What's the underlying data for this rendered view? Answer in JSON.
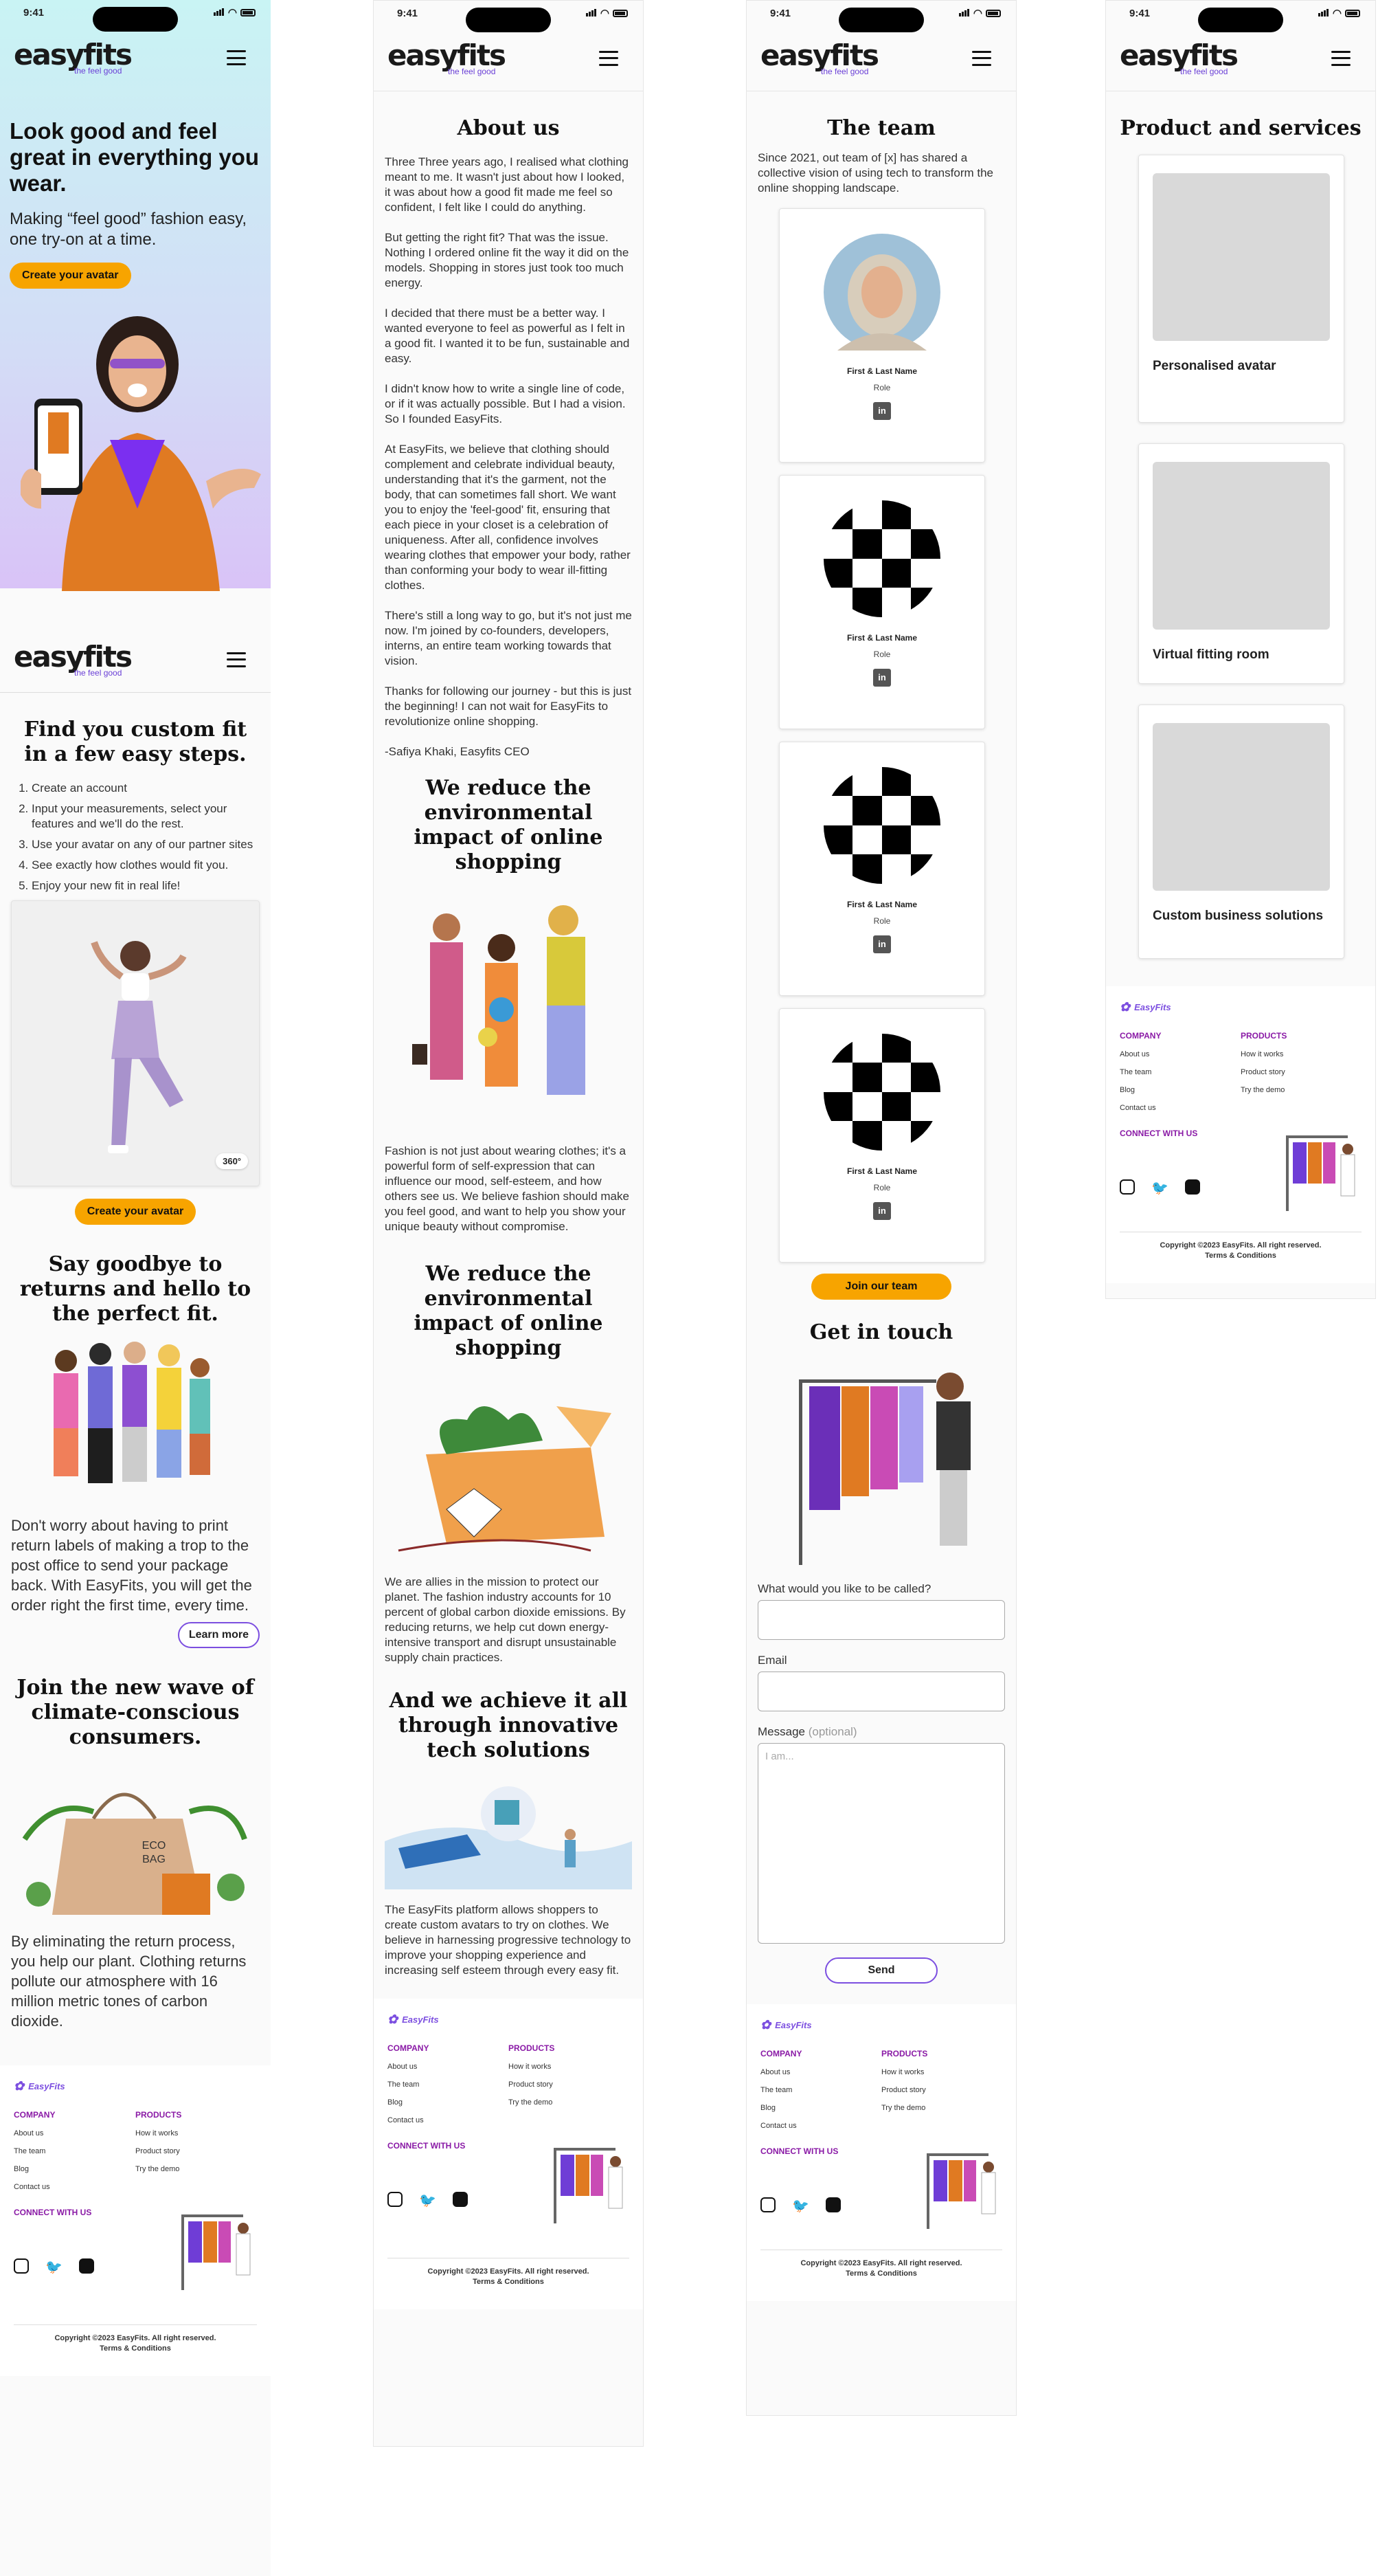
{
  "status": {
    "time": "9:41"
  },
  "brand": {
    "name": "easyfits",
    "tagline": "the feel good"
  },
  "screen1": {
    "hero_title": "Look good and feel great in everything you wear.",
    "hero_sub": "Making “feel good” fashion easy, one try-on at a time.",
    "hero_cta": "Create your avatar",
    "steps_title": "Find you custom fit in a few easy steps.",
    "steps": [
      "Create an account",
      "Input your measurements, select your features and we'll do the rest.",
      "Use your  avatar on any of our partner sites",
      "See exactly how clothes would fit you.",
      "Enjoy your new fit in real life!"
    ],
    "badge_360": "360°",
    "cta2": "Create your avatar",
    "returns_title": "Say goodbye to returns and hello to the perfect fit.",
    "returns_text": "Don't worry about having to print return labels of making a trop to the post office to send your package back. With EasyFits, you will get the order right the first time, every time.",
    "learn_more": "Learn more",
    "eco_title": "Join the new wave of climate-conscious consumers.",
    "eco_bag": "ECO BAG",
    "eco_text": "By eliminating the return process, you help our plant. Clothing returns pollute our atmosphere with 16 million metric tones of carbon dioxide."
  },
  "screen2": {
    "title": "About us",
    "paragraphs": [
      "Three Three years ago, I realised what clothing meant to me. It wasn't just about how I looked, it was about how a good fit made me feel so confident, I felt like I could do anything.",
      "But getting the right fit? That was the issue. Nothing I ordered online fit the way it did on the models. Shopping in stores just took too much energy.",
      "I decided that there must be a better way. I wanted everyone to feel as powerful as I felt in a good fit. I wanted it to be fun, sustainable and easy.",
      "I didn't know how to write a single line of code, or if it was actually possible. But I had a vision. So I founded EasyFits.",
      "At EasyFits, we believe that clothing should complement and celebrate individual beauty, understanding that it's the garment, not the body, that can sometimes fall short. We want you to enjoy the 'feel-good' fit, ensuring that each piece in your closet is a celebration of uniqueness. After all, confidence involves wearing clothes that empower your body, rather than conforming your body to wear ill-fitting clothes.",
      "There's still a long way to go, but it's not just me now. I'm joined by co-founders, developers, interns, an entire team working towards that vision.",
      "Thanks for following our journey - but this is just the beginning! I can not wait for EasyFits to revolutionize online shopping.",
      "-Safiya Khaki, Easyfits CEO"
    ],
    "impact_title": "We reduce the environmental impact of online shopping",
    "impact_text": "Fashion is not just about wearing clothes; it's a powerful form of self-expression that can influence our mood, self-esteem, and how others see us. We believe fashion should make you feel good, and want to help you show your unique beauty without compromise.",
    "impact2_title": "We reduce the environmental impact of online shopping",
    "impact2_text": "We are allies in the mission to protect our planet. The fashion industry accounts for 10 percent of global carbon dioxide emissions. By reducing returns, we help cut down energy-intensive transport and disrupt unsustainable supply chain practices.",
    "tech_title": "And we achieve it all through innovative tech solutions",
    "tech_text": "The EasyFits platform allows shoppers to create custom avatars to try on clothes. We believe in harnessing progressive technology to improve your shopping experience and increasing self esteem through every easy fit."
  },
  "screen3": {
    "title": "The team",
    "intro": "Since 2021, out team of [x] has shared a collective vision of using tech to transform the online shopping landscape.",
    "members": [
      {
        "name": "First & Last Name",
        "role": "Role"
      },
      {
        "name": "First & Last Name",
        "role": "Role"
      },
      {
        "name": "First & Last Name",
        "role": "Role"
      },
      {
        "name": "First & Last Name",
        "role": "Role"
      }
    ],
    "join": "Join our team",
    "contact_title": "Get in touch",
    "f_name": "What would you like to be called?",
    "f_email": "Email",
    "f_msg": "Message",
    "f_msg_opt": "(optional)",
    "f_msg_ph": "I am...",
    "send": "Send"
  },
  "screen4": {
    "title": "Product and services",
    "products": [
      "Personalised avatar",
      "Virtual fitting room",
      "Custom business solutions"
    ]
  },
  "footer": {
    "brand": "EasyFits",
    "company": "COMPANY",
    "company_links": [
      "About us",
      "The team",
      "Blog",
      "Contact us"
    ],
    "products": "PRODUCTS",
    "product_links": [
      "How it works",
      "Product story",
      "Try the demo"
    ],
    "connect": "CONNECT WITH US",
    "copyright": "Copyright ©2023 EasyFits. All right reserved.",
    "terms": "Terms & Conditions"
  },
  "colors": {
    "accent": "#f7a400",
    "purple": "#7c4fe0",
    "footer_heading": "#8a1aa6",
    "hero_gradient": [
      "#c9f4f4",
      "#d9c3f7"
    ]
  }
}
